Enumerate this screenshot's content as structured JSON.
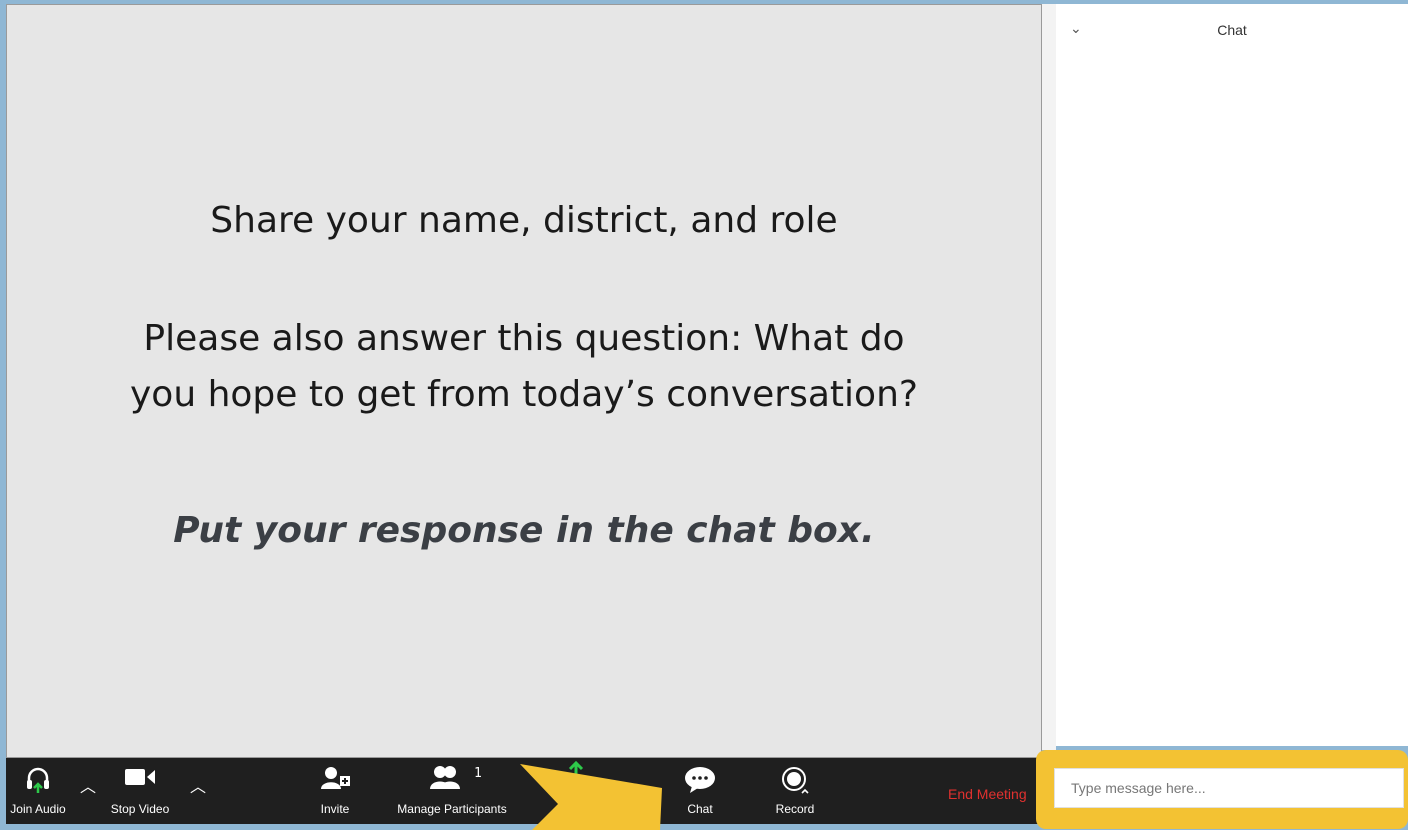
{
  "slide": {
    "line1": "Share your name, district, and role",
    "line2": "Please also answer this question: What do",
    "line3": "you hope to get from today’s conversation?",
    "line4": "Put your response in the chat box."
  },
  "toolbar": {
    "join_audio": "Join Audio",
    "stop_video": "Stop Video",
    "invite": "Invite",
    "manage_participants": "Manage Participants",
    "participant_count": "1",
    "chat": "Chat",
    "record": "Record",
    "end_meeting": "End Meeting"
  },
  "chat": {
    "title": "Chat",
    "placeholder": "Type message here..."
  },
  "colors": {
    "highlight": "#f3c233",
    "end_meeting": "#e0312f",
    "audio_arrow": "#2ec94a"
  },
  "icons": {
    "join_audio": "headphones-icon",
    "stop_video": "video-camera-icon",
    "invite": "add-user-icon",
    "manage_participants": "participants-icon",
    "share": "share-screen-icon",
    "chat": "chat-bubble-icon",
    "record": "record-icon",
    "collapse": "chevron-down-icon"
  }
}
